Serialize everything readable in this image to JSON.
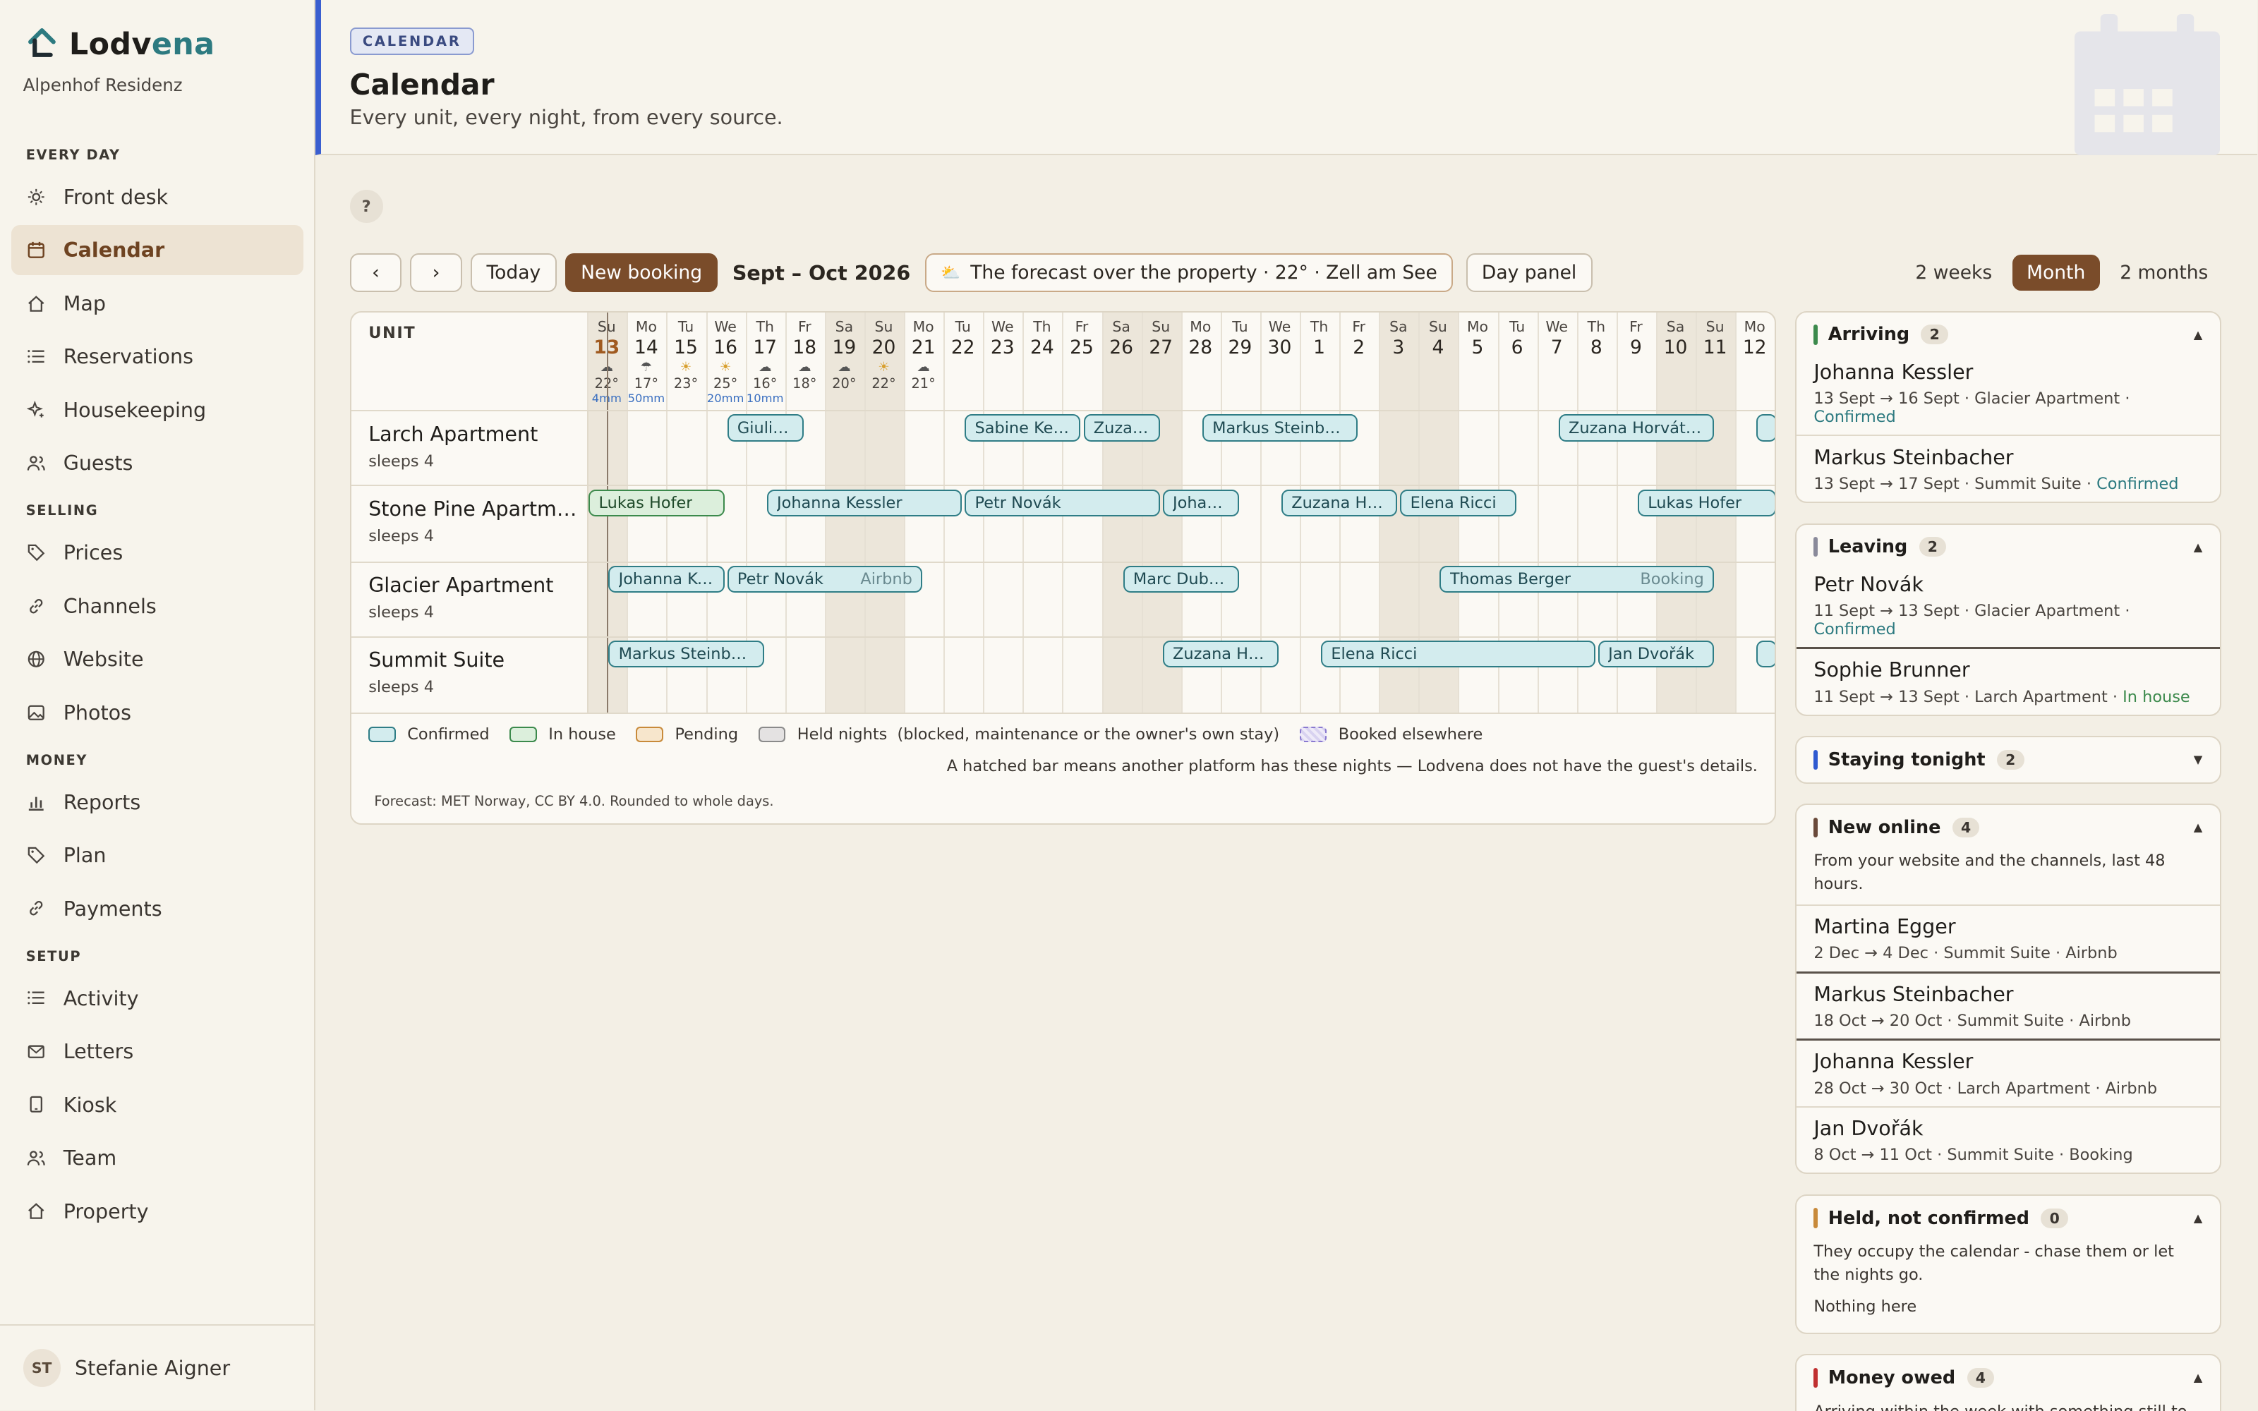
{
  "app": {
    "name_main": "Lodv",
    "name_accent": "ena",
    "property": "Alpenhof Residenz"
  },
  "nav": {
    "sections": [
      {
        "label": "EVERY DAY",
        "items": [
          {
            "label": "Front desk",
            "icon": "sun-icon"
          },
          {
            "label": "Calendar",
            "icon": "calendar-icon",
            "active": true
          },
          {
            "label": "Map",
            "icon": "home-icon"
          },
          {
            "label": "Reservations",
            "icon": "list-icon"
          },
          {
            "label": "Housekeeping",
            "icon": "sparkle-icon"
          },
          {
            "label": "Guests",
            "icon": "people-icon"
          }
        ]
      },
      {
        "label": "SELLING",
        "items": [
          {
            "label": "Prices",
            "icon": "tag-icon"
          },
          {
            "label": "Channels",
            "icon": "link-icon"
          },
          {
            "label": "Website",
            "icon": "globe-icon"
          },
          {
            "label": "Photos",
            "icon": "image-icon"
          }
        ]
      },
      {
        "label": "MONEY",
        "items": [
          {
            "label": "Reports",
            "icon": "bar-chart-icon"
          },
          {
            "label": "Plan",
            "icon": "tag-icon"
          },
          {
            "label": "Payments",
            "icon": "link-icon"
          }
        ]
      },
      {
        "label": "SETUP",
        "items": [
          {
            "label": "Activity",
            "icon": "list-icon"
          },
          {
            "label": "Letters",
            "icon": "mail-icon"
          },
          {
            "label": "Kiosk",
            "icon": "tablet-icon"
          },
          {
            "label": "Team",
            "icon": "people-icon"
          },
          {
            "label": "Property",
            "icon": "home-icon"
          }
        ]
      }
    ]
  },
  "user": {
    "initials": "ST",
    "name": "Stefanie Aigner"
  },
  "header": {
    "crumb": "CALENDAR",
    "title": "Calendar",
    "subtitle": "Every unit, every night, from every source."
  },
  "toolbar": {
    "help": "?",
    "today": "Today",
    "new_booking": "New booking",
    "range": "Sept – Oct 2026",
    "forecast": "The forecast over the property · 22° · Zell am See",
    "day_panel": "Day panel",
    "views": [
      {
        "label": "2 weeks"
      },
      {
        "label": "Month",
        "active": true
      },
      {
        "label": "2 months"
      }
    ]
  },
  "calendar": {
    "unit_header": "UNIT",
    "days": [
      {
        "dn": "Su",
        "dd": "13",
        "we": true,
        "today": true,
        "wi": "☁",
        "wt": "22°",
        "wr": "4mm"
      },
      {
        "dn": "Mo",
        "dd": "14",
        "wi": "☂",
        "wt": "17°",
        "wr": "50mm"
      },
      {
        "dn": "Tu",
        "dd": "15",
        "wi": "☀",
        "wt": "23°"
      },
      {
        "dn": "We",
        "dd": "16",
        "wi": "☀",
        "wt": "25°",
        "wr": "20mm"
      },
      {
        "dn": "Th",
        "dd": "17",
        "wi": "☁",
        "wt": "16°",
        "wr": "10mm"
      },
      {
        "dn": "Fr",
        "dd": "18",
        "wi": "☁",
        "wt": "18°"
      },
      {
        "dn": "Sa",
        "dd": "19",
        "we": true,
        "wi": "☁",
        "wt": "20°"
      },
      {
        "dn": "Su",
        "dd": "20",
        "we": true,
        "wi": "☀",
        "wt": "22°"
      },
      {
        "dn": "Mo",
        "dd": "21",
        "wi": "☁",
        "wt": "21°"
      },
      {
        "dn": "Tu",
        "dd": "22"
      },
      {
        "dn": "We",
        "dd": "23"
      },
      {
        "dn": "Th",
        "dd": "24"
      },
      {
        "dn": "Fr",
        "dd": "25"
      },
      {
        "dn": "Sa",
        "dd": "26",
        "we": true
      },
      {
        "dn": "Su",
        "dd": "27",
        "we": true
      },
      {
        "dn": "Mo",
        "dd": "28"
      },
      {
        "dn": "Tu",
        "dd": "29"
      },
      {
        "dn": "We",
        "dd": "30"
      },
      {
        "dn": "Th",
        "dd": "1"
      },
      {
        "dn": "Fr",
        "dd": "2"
      },
      {
        "dn": "Sa",
        "dd": "3",
        "we": true
      },
      {
        "dn": "Su",
        "dd": "4",
        "we": true
      },
      {
        "dn": "Mo",
        "dd": "5"
      },
      {
        "dn": "Tu",
        "dd": "6"
      },
      {
        "dn": "We",
        "dd": "7"
      },
      {
        "dn": "Th",
        "dd": "8"
      },
      {
        "dn": "Fr",
        "dd": "9"
      },
      {
        "dn": "Sa",
        "dd": "10",
        "we": true
      },
      {
        "dn": "Su",
        "dd": "11",
        "we": true
      },
      {
        "dn": "Mo",
        "dd": "12"
      }
    ],
    "units": [
      {
        "name": "Larch Apartment",
        "sub": "sleeps 4",
        "bookings": [
          {
            "label": "Giulia…",
            "start": 3.5,
            "end": 5.5
          },
          {
            "label": "Sabine Keller",
            "start": 9.5,
            "end": 12.5
          },
          {
            "label": "Zuzan…",
            "start": 12.5,
            "end": 14.5
          },
          {
            "label": "Markus Steinbac…",
            "start": 15.5,
            "end": 19.5
          },
          {
            "label": "Zuzana Horváth…",
            "start": 24.5,
            "end": 28.5
          },
          {
            "label": "",
            "start": 29.5,
            "end": 31
          }
        ]
      },
      {
        "name": "Stone Pine Apartme…",
        "sub": "sleeps 4",
        "bookings": [
          {
            "label": "Lukas Hofer",
            "start": 0,
            "end": 3.5,
            "status": "house"
          },
          {
            "label": "Johanna Kessler",
            "start": 4.5,
            "end": 9.5
          },
          {
            "label": "Petr Novák",
            "start": 9.5,
            "end": 14.5
          },
          {
            "label": "Johan…",
            "start": 14.5,
            "end": 16.5
          },
          {
            "label": "Zuzana Ho…",
            "start": 17.5,
            "end": 20.5
          },
          {
            "label": "Elena Ricci",
            "start": 20.5,
            "end": 23.5
          },
          {
            "label": "Lukas Hofer",
            "start": 26.5,
            "end": 30.5
          }
        ]
      },
      {
        "name": "Glacier Apartment",
        "sub": "sleeps 4",
        "bookings": [
          {
            "label": "Johanna Ke…",
            "start": 0.5,
            "end": 3.5
          },
          {
            "label": "Petr Novák",
            "start": 3.5,
            "end": 8.5,
            "source": "Airbnb"
          },
          {
            "label": "Marc Dubois",
            "start": 13.5,
            "end": 16.5
          },
          {
            "label": "Thomas Berger",
            "start": 21.5,
            "end": 28.5,
            "source": "Booking"
          }
        ]
      },
      {
        "name": "Summit Suite",
        "sub": "sleeps 4",
        "bookings": [
          {
            "label": "Markus Steinbac…",
            "start": 0.5,
            "end": 4.5
          },
          {
            "label": "Zuzana Ho…",
            "start": 14.5,
            "end": 17.5
          },
          {
            "label": "Elena Ricci",
            "start": 18.5,
            "end": 25.5
          },
          {
            "label": "Jan Dvořák",
            "start": 25.5,
            "end": 28.5
          },
          {
            "label": "",
            "start": 29.5,
            "end": 31
          }
        ]
      }
    ],
    "legend": {
      "confirmed": "Confirmed",
      "in_house": "In house",
      "pending": "Pending",
      "held": "Held nights  (blocked, maintenance or the owner's own stay)",
      "elsewhere": "Booked elsewhere"
    },
    "note": "A hatched bar means another platform has these nights — Lodvena does not have the guest's details.",
    "forecast_note": "Forecast: MET Norway, CC BY 4.0. Rounded to whole days."
  },
  "colors": {
    "accent": "#7a4c2a",
    "confirmed": "#2f7d86",
    "in_house": "#3c8a4c",
    "pending": "#c88a3a",
    "held": "#8a8a8a",
    "elsewhere": "#8a7ad0"
  },
  "panels": [
    {
      "title": "Arriving",
      "count": "2",
      "color": "#3c8a4c",
      "open": true,
      "items": [
        {
          "name": "Johanna Kessler",
          "meta": "13 Sept → 16 Sept  · Glacier Apartment  · ",
          "status": "Confirmed",
          "st": "ok"
        },
        {
          "name": "Markus Steinbacher",
          "meta": "13 Sept → 17 Sept  · Summit Suite  · ",
          "status": "Confirmed",
          "st": "ok"
        }
      ]
    },
    {
      "title": "Leaving",
      "count": "2",
      "color": "#8a8a9a",
      "open": true,
      "items": [
        {
          "name": "Petr Novák",
          "meta": "11 Sept → 13 Sept  · Glacier Apartment  · ",
          "status": "Confirmed",
          "st": "ok"
        },
        {
          "name": "Sophie Brunner",
          "meta": "11 Sept → 13 Sept  · Larch Apartment  · ",
          "status": "In house",
          "st": "ih",
          "dark": true
        }
      ]
    },
    {
      "title": "Staying tonight",
      "count": "2",
      "color": "#2f5ad0",
      "open": false,
      "items": []
    },
    {
      "title": "New online",
      "count": "4",
      "color": "#6a4a3a",
      "open": true,
      "desc": "From your website and the channels, last 48 hours.",
      "items": [
        {
          "name": "Martina Egger",
          "meta": "2 Dec → 4 Dec  · Summit Suite  · Airbnb"
        },
        {
          "name": "Markus Steinbacher",
          "meta": "18 Oct → 20 Oct  · Summit Suite  · Airbnb",
          "dark": true
        },
        {
          "name": "Johanna Kessler",
          "meta": "28 Oct → 30 Oct  · Larch Apartment  · Airbnb",
          "dark": true
        },
        {
          "name": "Jan Dvořák",
          "meta": "8 Oct → 11 Oct  · Summit Suite  · Booking"
        }
      ]
    },
    {
      "title": "Held, not confirmed",
      "count": "0",
      "color": "#c88a3a",
      "open": true,
      "desc": "They occupy the calendar - chase them or let the nights go.",
      "empty": "Nothing here",
      "items": []
    },
    {
      "title": "Money owed",
      "count": "4",
      "color": "#c03030",
      "open": true,
      "desc": "Arriving within the week with something still to pay.",
      "items": []
    }
  ]
}
